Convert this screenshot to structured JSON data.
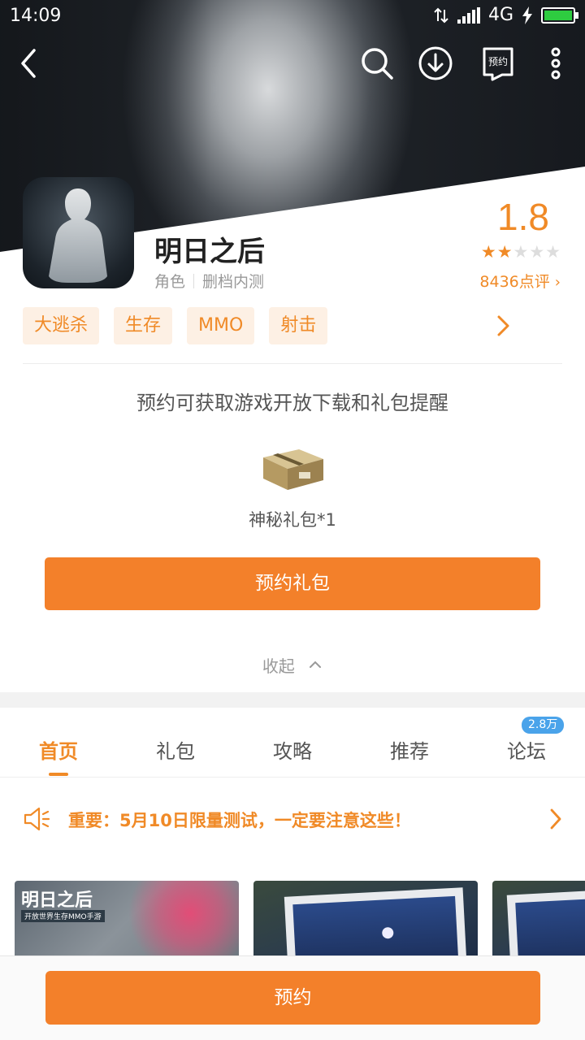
{
  "status_bar": {
    "time": "14:09",
    "network": "4G"
  },
  "top_bar": {
    "bookmark_label": "预约"
  },
  "game": {
    "title": "明日之后",
    "category": "角色",
    "test_status": "删档内测",
    "rating": "1.8",
    "stars_on": 2,
    "stars_total": 5,
    "reviews": "8436点评"
  },
  "tags": [
    "大逃杀",
    "生存",
    "MMO",
    "射击"
  ],
  "reserve_section": {
    "hint": "预约可获取游戏开放下载和礼包提醒",
    "gift_label": "神秘礼包*1",
    "gift_button": "预约礼包",
    "collapse_label": "收起"
  },
  "tabs": [
    {
      "label": "首页",
      "active": true
    },
    {
      "label": "礼包"
    },
    {
      "label": "攻略"
    },
    {
      "label": "推荐"
    },
    {
      "label": "论坛",
      "badge": "2.8万"
    }
  ],
  "notice": {
    "text": "重要：5月10日限量测试，一定要注意这些！"
  },
  "thumbnails": [
    {
      "title": "明日之后",
      "subtitle": "开放世界生存MMO手游"
    },
    {
      "title": ""
    },
    {
      "title": ""
    }
  ],
  "bottom": {
    "reserve_button": "预约"
  },
  "colors": {
    "accent": "#f08a27",
    "button": "#f3802a",
    "badge": "#4aa3ea"
  }
}
